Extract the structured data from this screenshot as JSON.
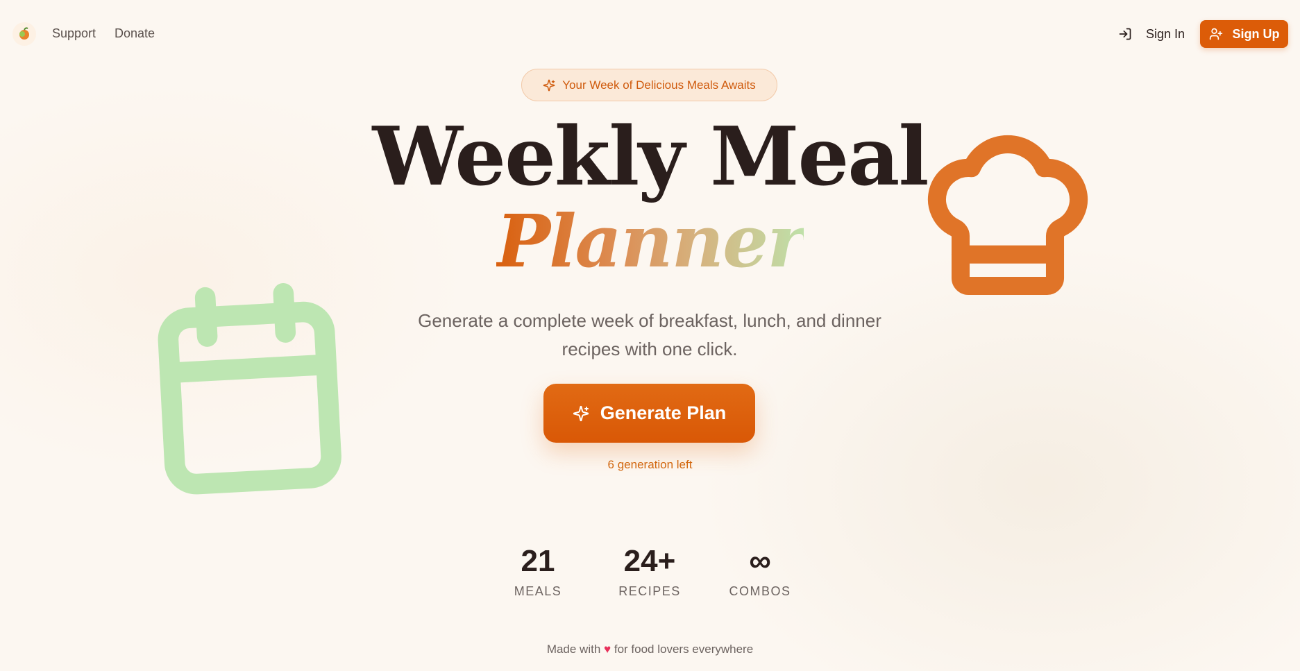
{
  "nav": {
    "links": [
      {
        "label": "Support"
      },
      {
        "label": "Donate"
      }
    ],
    "signin_label": "Sign In",
    "signup_label": "Sign Up"
  },
  "hero": {
    "badge": "Your Week of Delicious Meals Awaits",
    "title_line1": "Weekly Meal",
    "title_line2": "Planner",
    "description": "Generate a complete week of breakfast, lunch, and dinner recipes with one click.",
    "cta_label": "Generate Plan",
    "generations_left": "6 generation left"
  },
  "stats": [
    {
      "value": "21",
      "label": "MEALS"
    },
    {
      "value": "24+",
      "label": "RECIPES"
    },
    {
      "value": "∞",
      "label": "COMBOS"
    }
  ],
  "footer": {
    "prefix": "Made with",
    "heart": "♥",
    "suffix": "for food lovers everywhere"
  },
  "icons": {
    "logo": "fruit-logo-icon",
    "signin": "sign-in-arrow-icon",
    "signup": "user-plus-icon",
    "sparkle": "sparkles-icon",
    "decor_chef": "chef-hat-icon",
    "decor_calendar": "calendar-icon"
  },
  "colors": {
    "accent": "#dc5c08",
    "background": "#fcf7f1",
    "text": "#2a1e1c",
    "calendar_green": "#bde6b2",
    "chef_orange": "#e07428"
  }
}
